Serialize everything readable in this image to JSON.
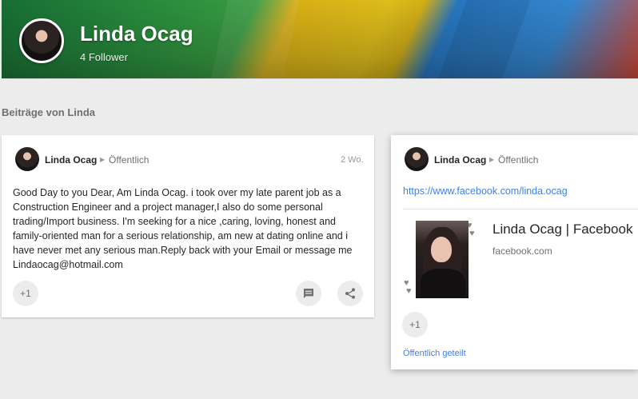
{
  "header": {
    "name": "Linda Ocag",
    "followers": "4 Follower"
  },
  "section": {
    "title": "Beiträge von Linda"
  },
  "posts": [
    {
      "author": "Linda Ocag",
      "visibility": "Öffentlich",
      "time": "2 Wo.",
      "text": "Good Day to you Dear, Am Linda Ocag. i took over my late parent job as a Construction Engineer and a project manager,I also do some personal trading/Import business. I'm seeking for a nice ,caring, loving, honest and family-oriented man for a serious relationship, am new at dating online and i have never met any serious man.Reply back with your Email or message me Lindaocag@hotmail.com",
      "plus_one": "+1"
    },
    {
      "author": "Linda Ocag",
      "visibility": "Öffentlich",
      "link_url": "https://www.facebook.com/linda.ocag",
      "preview_title": "Linda Ocag | Facebook",
      "preview_domain": "facebook.com",
      "plus_one": "+1",
      "shared_label": "Öffentlich geteilt"
    }
  ],
  "colors": {
    "link": "#427fed",
    "background": "#ececec"
  },
  "icons": {
    "comment": "comment-icon",
    "share": "share-icon"
  }
}
